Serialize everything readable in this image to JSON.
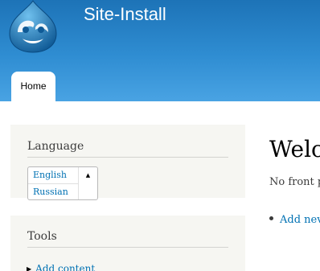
{
  "header": {
    "site_name": "Site-Install",
    "logo_icon": "drupal-drop-logo",
    "background_color": "#2f8dd2"
  },
  "tabs": [
    {
      "label": "Home",
      "active": true
    }
  ],
  "sidebar": {
    "language_block": {
      "title": "Language",
      "options": [
        "English",
        "Russian"
      ],
      "toggle_icon": "triangle-up-icon"
    },
    "tools_block": {
      "title": "Tools",
      "items": [
        {
          "label": "Add content",
          "icon": "triangle-right-icon"
        }
      ]
    }
  },
  "main": {
    "title": "Welc",
    "message": "No front p",
    "links": [
      "Add nev"
    ]
  },
  "colors": {
    "link": "#0071b3",
    "sidebar_bg": "#f6f6f2"
  }
}
